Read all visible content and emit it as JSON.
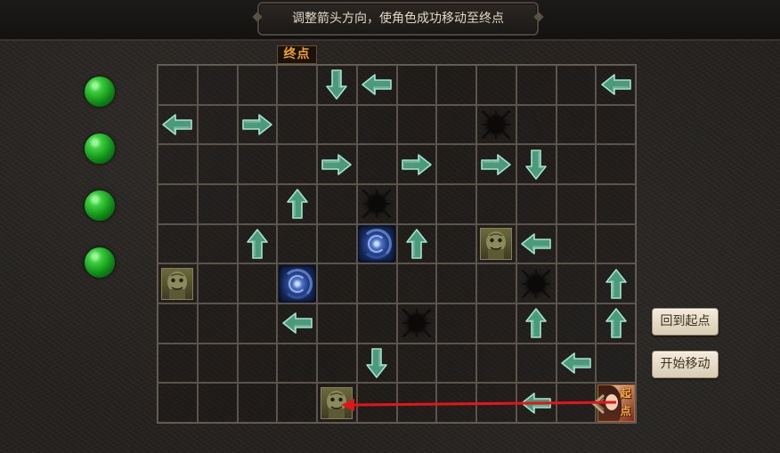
{
  "instruction": "调整箭头方向，使角色成功移动至终点",
  "goal_label": "终点",
  "player_tag": "起点",
  "buttons": {
    "reset": "回到起点",
    "start": "开始移动"
  },
  "gems_count": 4,
  "colors": {
    "arrow_fill": "#4b9a7e",
    "arrow_light": "#a8e3cc",
    "path_red": "#e4151a",
    "gem_green": "#2bbf2b"
  },
  "grid": {
    "cols": 12,
    "rows": 9,
    "cells": [
      [
        "",
        "",
        "",
        "",
        "down",
        "left",
        "",
        "",
        "",
        "",
        "",
        "left"
      ],
      [
        "left",
        "",
        "right",
        "",
        "",
        "",
        "",
        "",
        "hole",
        "",
        "",
        ""
      ],
      [
        "",
        "",
        "",
        "",
        "right",
        "",
        "right",
        "",
        "right",
        "down",
        "",
        ""
      ],
      [
        "",
        "",
        "",
        "up",
        "",
        "hole",
        "",
        "",
        "",
        "",
        "",
        ""
      ],
      [
        "",
        "",
        "up",
        "",
        "",
        "portal",
        "up",
        "",
        "monster",
        "left",
        "",
        ""
      ],
      [
        "monster",
        "",
        "",
        "portal",
        "",
        "",
        "",
        "",
        "",
        "hole",
        "",
        "up"
      ],
      [
        "",
        "",
        "",
        "left",
        "",
        "",
        "hole",
        "",
        "",
        "up",
        "",
        "up"
      ],
      [
        "",
        "",
        "",
        "",
        "",
        "down",
        "",
        "",
        "",
        "",
        "left",
        ""
      ],
      [
        "",
        "",
        "",
        "",
        "monster",
        "",
        "",
        "",
        "",
        "left",
        "",
        "player"
      ]
    ]
  }
}
